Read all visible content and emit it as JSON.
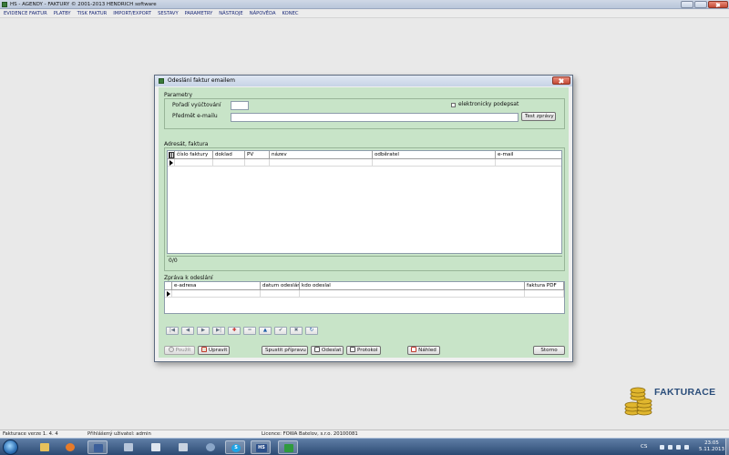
{
  "app": {
    "title": "HS - AGENDY - FAKTURY © 2001-2013 HENDRICH software"
  },
  "menu": [
    "EVIDENCE FAKTUR",
    "PLATBY",
    "TISK FAKTUR",
    "IMPORT/EXPORT",
    "SESTAVY",
    "PARAMETRY",
    "NÁSTROJE",
    "NÁPOVĚDA",
    "KONEC"
  ],
  "dialog": {
    "title": "Odeslání faktur emailem",
    "parametry": {
      "group_label": "Parametry",
      "poradi_label": "Pořadí vyúčtování",
      "poradi_value": "",
      "predmet_label": "Předmět e-mailu",
      "predmet_value": "",
      "test_button": "Test zprávy",
      "signed_checkbox_label": "elektronicky podepsat",
      "signed_checked": false
    },
    "invoices": {
      "group_label": "Adresát, faktura",
      "columns": [
        "číslo faktury",
        "doklad",
        "PV",
        "název",
        "odběratel",
        "e-mail"
      ],
      "counter": "0/0"
    },
    "messages": {
      "group_label": "Zpráva k odeslání",
      "columns": [
        "e-adresa",
        "datum odeslání",
        "kdo odeslal",
        "faktura PDF"
      ]
    },
    "nav": [
      "|◀",
      "◀",
      "▶",
      "▶|",
      "✚",
      "━",
      "▲",
      "✔",
      "✖",
      "↻"
    ],
    "buttons": {
      "pouzit": "Použít",
      "upravit": "Upravit",
      "spustit": "Spustit přípravu",
      "odeslat": "Odeslat",
      "protokol": "Protokol",
      "nahled": "Náhled",
      "storno": "Storno"
    }
  },
  "logo": {
    "text": "FAKTURACE"
  },
  "statusbar": {
    "version": "Fakturace verze   1. 4. 4",
    "user": "Přihlášený uživatel: admin",
    "license": "Licence: FOWA Batelov, s.r.o. 20100081"
  },
  "taskbar": {
    "lang": "CS",
    "time": "23:05",
    "date": "5.11.2013",
    "hs_label": "HS"
  },
  "colors": {
    "dialog_panel": "#c8e4c8",
    "link_menu": "#1b2a78",
    "taskbar": "#2c4a73"
  }
}
